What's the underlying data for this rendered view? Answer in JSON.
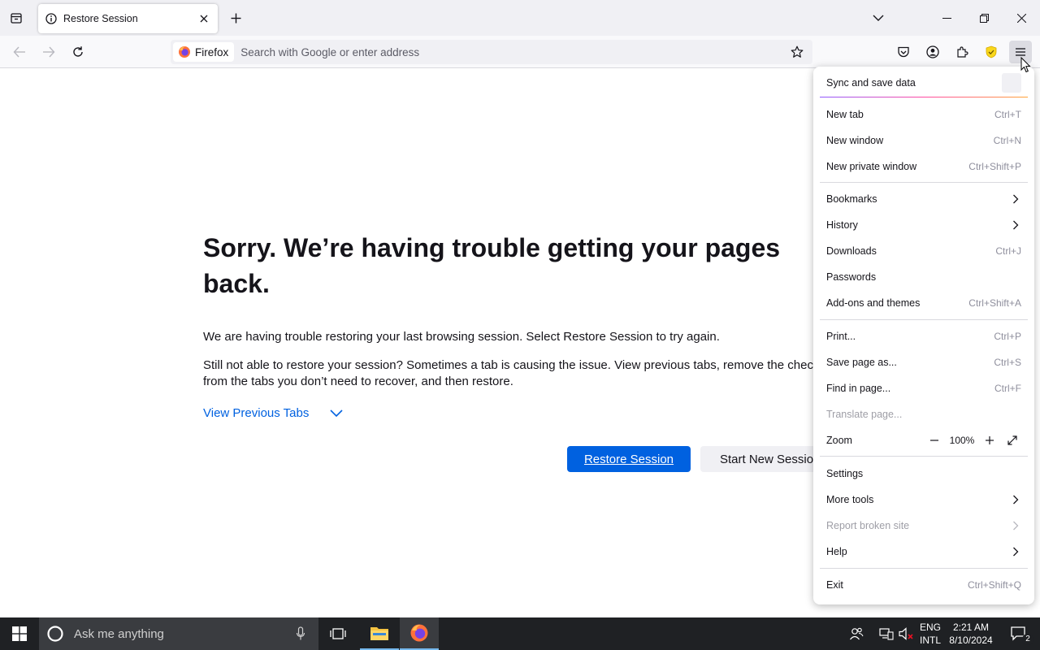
{
  "tabs": [
    {
      "title": "Restore Session"
    }
  ],
  "urlbar": {
    "identity_label": "Firefox",
    "placeholder": "Search with Google or enter address"
  },
  "page": {
    "title": "Sorry. We’re having trouble getting your pages back.",
    "para1": "We are having trouble restoring your last browsing session. Select Restore Session to try again.",
    "para2_line1": "Still not able to restore your session? Sometimes a tab is causing the issue. View previous tabs, remove the checkm",
    "para2_line2": "from the tabs you don’t need to recover, and then restore.",
    "view_previous_tabs": "View Previous Tabs",
    "restore_button": "Restore Session",
    "new_session_button": "Start New Session"
  },
  "menu": {
    "sync": "Sync and save data",
    "items": [
      {
        "label": "New tab",
        "shortcut": "Ctrl+T"
      },
      {
        "label": "New window",
        "shortcut": "Ctrl+N"
      },
      {
        "label": "New private window",
        "shortcut": "Ctrl+Shift+P"
      },
      {
        "label": "Bookmarks",
        "shortcut": ""
      },
      {
        "label": "History",
        "shortcut": ""
      },
      {
        "label": "Downloads",
        "shortcut": "Ctrl+J"
      },
      {
        "label": "Passwords",
        "shortcut": ""
      },
      {
        "label": "Add-ons and themes",
        "shortcut": "Ctrl+Shift+A"
      },
      {
        "label": "Print...",
        "shortcut": "Ctrl+P"
      },
      {
        "label": "Save page as...",
        "shortcut": "Ctrl+S"
      },
      {
        "label": "Find in page...",
        "shortcut": "Ctrl+F"
      },
      {
        "label": "Translate page...",
        "shortcut": ""
      },
      {
        "label": "Zoom",
        "shortcut": ""
      },
      {
        "label": "Settings",
        "shortcut": ""
      },
      {
        "label": "More tools",
        "shortcut": ""
      },
      {
        "label": "Report broken site",
        "shortcut": ""
      },
      {
        "label": "Help",
        "shortcut": ""
      },
      {
        "label": "Exit",
        "shortcut": "Ctrl+Shift+Q"
      }
    ],
    "zoom_value": "100%"
  },
  "taskbar": {
    "search_placeholder": "Ask me anything",
    "lang_line1": "ENG",
    "lang_line2": "INTL",
    "time": "2:21 AM",
    "date": "8/10/2024",
    "notification_count": "2"
  },
  "colors": {
    "accent_blue": "#0061e0",
    "menu_gradient": [
      "#9059ff",
      "#ff4aa2",
      "#ffa436"
    ]
  }
}
